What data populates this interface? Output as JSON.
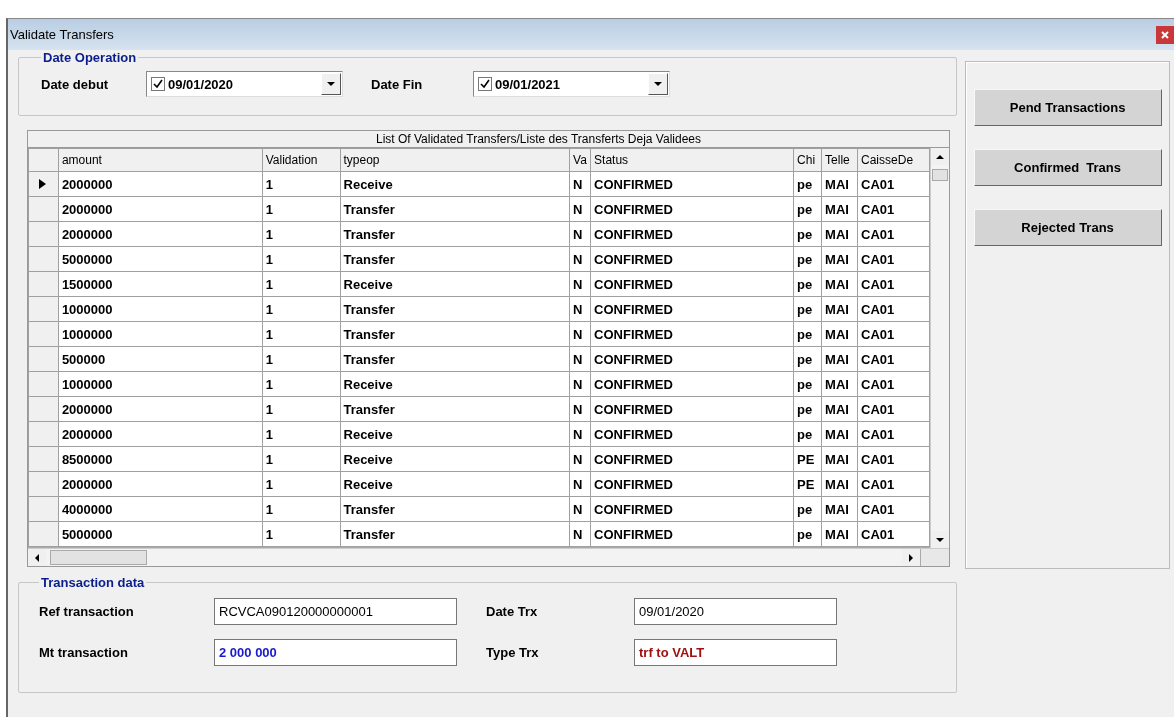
{
  "window": {
    "title": "Validate Transfers"
  },
  "date_operation": {
    "title": "Date Operation",
    "fields": [
      {
        "label": "Date debut",
        "value": "09/01/2020",
        "checked": true
      },
      {
        "label": "Date Fin",
        "value": "09/01/2021",
        "checked": true
      }
    ]
  },
  "grid": {
    "caption": "List Of Validated Transfers/Liste des Transferts Deja Validees",
    "columns": [
      "amount",
      "Validation",
      "typeop",
      "Va",
      "Status",
      "Chi",
      "Telle",
      "CaisseDe"
    ],
    "rows": [
      {
        "selected": true,
        "cells": [
          "2000000",
          "1",
          "Receive",
          "N",
          "CONFIRMED",
          "pe",
          "MAI",
          "CA01"
        ]
      },
      {
        "selected": false,
        "cells": [
          "2000000",
          "1",
          "Transfer",
          "N",
          "CONFIRMED",
          "pe",
          "MAI",
          "CA01"
        ]
      },
      {
        "selected": false,
        "cells": [
          "2000000",
          "1",
          "Transfer",
          "N",
          "CONFIRMED",
          "pe",
          "MAI",
          "CA01"
        ]
      },
      {
        "selected": false,
        "cells": [
          "5000000",
          "1",
          "Transfer",
          "N",
          "CONFIRMED",
          "pe",
          "MAI",
          "CA01"
        ]
      },
      {
        "selected": false,
        "cells": [
          "1500000",
          "1",
          "Receive",
          "N",
          "CONFIRMED",
          "pe",
          "MAI",
          "CA01"
        ]
      },
      {
        "selected": false,
        "cells": [
          "1000000",
          "1",
          "Transfer",
          "N",
          "CONFIRMED",
          "pe",
          "MAI",
          "CA01"
        ]
      },
      {
        "selected": false,
        "cells": [
          "1000000",
          "1",
          "Transfer",
          "N",
          "CONFIRMED",
          "pe",
          "MAI",
          "CA01"
        ]
      },
      {
        "selected": false,
        "cells": [
          "500000",
          "1",
          "Transfer",
          "N",
          "CONFIRMED",
          "pe",
          "MAI",
          "CA01"
        ]
      },
      {
        "selected": false,
        "cells": [
          "1000000",
          "1",
          "Receive",
          "N",
          "CONFIRMED",
          "pe",
          "MAI",
          "CA01"
        ]
      },
      {
        "selected": false,
        "cells": [
          "2000000",
          "1",
          "Transfer",
          "N",
          "CONFIRMED",
          "pe",
          "MAI",
          "CA01"
        ]
      },
      {
        "selected": false,
        "cells": [
          "2000000",
          "1",
          "Receive",
          "N",
          "CONFIRMED",
          "pe",
          "MAI",
          "CA01"
        ]
      },
      {
        "selected": false,
        "cells": [
          "8500000",
          "1",
          "Receive",
          "N",
          "CONFIRMED",
          "PE",
          "MAI",
          "CA01"
        ]
      },
      {
        "selected": false,
        "cells": [
          "2000000",
          "1",
          "Receive",
          "N",
          "CONFIRMED",
          "PE",
          "MAI",
          "CA01"
        ]
      },
      {
        "selected": false,
        "cells": [
          "4000000",
          "1",
          "Transfer",
          "N",
          "CONFIRMED",
          "pe",
          "MAI",
          "CA01"
        ]
      },
      {
        "selected": false,
        "cells": [
          "5000000",
          "1",
          "Transfer",
          "N",
          "CONFIRMED",
          "pe",
          "MAI",
          "CA01"
        ]
      }
    ]
  },
  "buttons": [
    "Pend Transactions",
    "Confirmed  Trans",
    "Rejected Trans"
  ],
  "transaction_data": {
    "title": "Transaction data",
    "fields": [
      {
        "label": "Ref transaction",
        "value": "RCVCA090120000000001",
        "color": "#000000"
      },
      {
        "label": "Date Trx",
        "value": "09/01/2020",
        "color": "#000000"
      },
      {
        "label": "Mt transaction",
        "value": "2 000 000",
        "color": "#1a1acc"
      },
      {
        "label": "Type Trx",
        "value": "trf to VALT",
        "color": "#a01010"
      }
    ]
  }
}
